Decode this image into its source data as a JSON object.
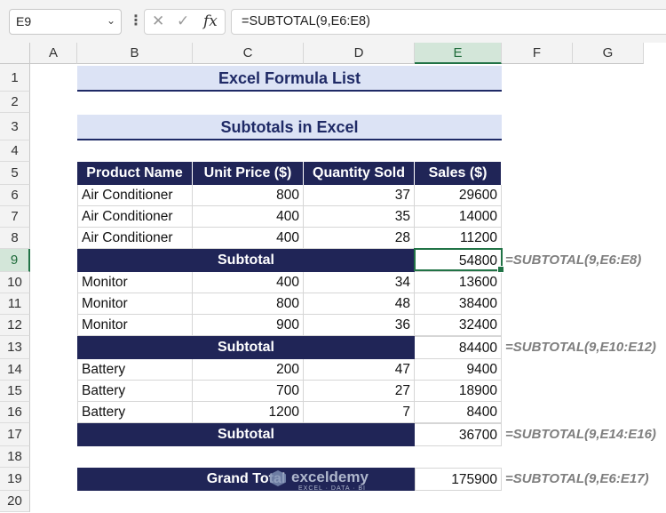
{
  "name_box": "E9",
  "formula_bar": "=SUBTOTAL(9,E6:E8)",
  "icons": {
    "cancel": "close-icon",
    "enter": "check-icon",
    "function": "fx-icon",
    "name_dropdown": "chevron-down-icon"
  },
  "columns": [
    "A",
    "B",
    "C",
    "D",
    "E",
    "F",
    "G"
  ],
  "rows": [
    "1",
    "2",
    "3",
    "4",
    "5",
    "6",
    "7",
    "8",
    "9",
    "10",
    "11",
    "12",
    "13",
    "14",
    "15",
    "16",
    "17",
    "18",
    "19",
    "20"
  ],
  "title": "Excel Formula List",
  "subtitle": "Subtotals in Excel",
  "headers": [
    "Product Name",
    "Unit Price ($)",
    "Quantity Sold",
    "Sales ($)"
  ],
  "groups": [
    {
      "rows": [
        [
          "Air Conditioner",
          "800",
          "37",
          "29600"
        ],
        [
          "Air Conditioner",
          "400",
          "35",
          "14000"
        ],
        [
          "Air Conditioner",
          "400",
          "28",
          "11200"
        ]
      ],
      "subtotal_label": "Subtotal",
      "subtotal": "54800",
      "formula": "=SUBTOTAL(9,E6:E8)"
    },
    {
      "rows": [
        [
          "Monitor",
          "400",
          "34",
          "13600"
        ],
        [
          "Monitor",
          "800",
          "48",
          "38400"
        ],
        [
          "Monitor",
          "900",
          "36",
          "32400"
        ]
      ],
      "subtotal_label": "Subtotal",
      "subtotal": "84400",
      "formula": "=SUBTOTAL(9,E10:E12)"
    },
    {
      "rows": [
        [
          "Battery",
          "200",
          "47",
          "9400"
        ],
        [
          "Battery",
          "700",
          "27",
          "18900"
        ],
        [
          "Battery",
          "1200",
          "7",
          "8400"
        ]
      ],
      "subtotal_label": "Subtotal",
      "subtotal": "36700",
      "formula": "=SUBTOTAL(9,E14:E16)"
    }
  ],
  "grand_total": {
    "label": "Grand Total",
    "value": "175900",
    "formula": "=SUBTOTAL(9,E6:E17)"
  },
  "watermark": {
    "brand": "exceldemy",
    "tag": "EXCEL · DATA · BI"
  },
  "colors": {
    "header_bg": "#202557",
    "title_bg": "#dce3f5",
    "selection": "#217346"
  }
}
